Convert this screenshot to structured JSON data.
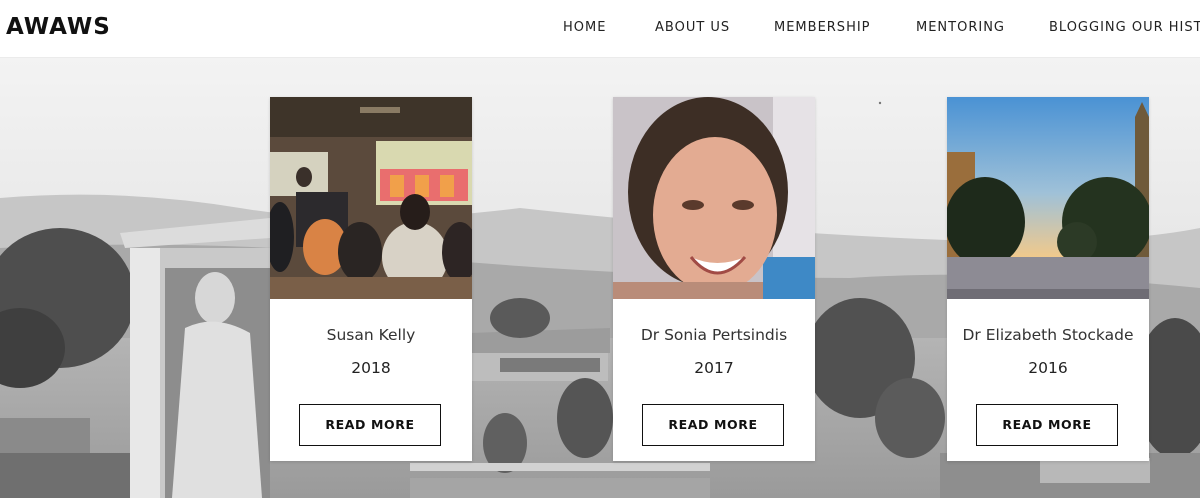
{
  "header": {
    "logo": "AWAWS",
    "nav": [
      {
        "label": "HOME"
      },
      {
        "label": "ABOUT US"
      },
      {
        "label": "MEMBERSHIP"
      },
      {
        "label": "MENTORING"
      },
      {
        "label": "BLOGGING OUR HISTORY"
      }
    ]
  },
  "cards": [
    {
      "name": "Susan Kelly",
      "year": "2018",
      "button": "READ MORE"
    },
    {
      "name": "Dr Sonia Pertsindis",
      "year": "2017",
      "button": "READ MORE"
    },
    {
      "name": "Dr Elizabeth Stockade",
      "year": "2016",
      "button": "READ MORE"
    }
  ]
}
